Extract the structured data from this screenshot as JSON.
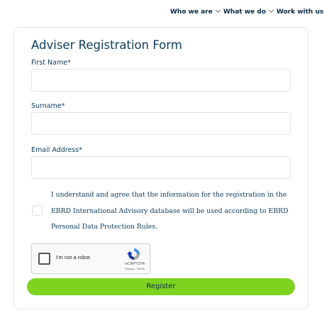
{
  "nav": {
    "items": [
      {
        "label": "Who we are"
      },
      {
        "label": "What we do"
      },
      {
        "label": "Work with us"
      }
    ]
  },
  "form": {
    "title": "Adviser Registration Form",
    "first_name_label": "First Name*",
    "first_name_value": "",
    "surname_label": "Surname*",
    "surname_value": "",
    "email_label": "Email Address*",
    "email_value": "",
    "consent_lines": [
      "I understand and agree that the information for the registration in the",
      "EBRD International Advisory database will be used according to EBRD",
      "Personal Data Protection Rules."
    ],
    "consent_checked": false
  },
  "recaptcha": {
    "label": "I'm not a robot",
    "brand": "reCAPTCHA",
    "links": "Privacy - Terms"
  },
  "register": {
    "label": "Register"
  },
  "colors": {
    "accent_green": "#7ed321",
    "text_navy": "#0d3b5c"
  }
}
